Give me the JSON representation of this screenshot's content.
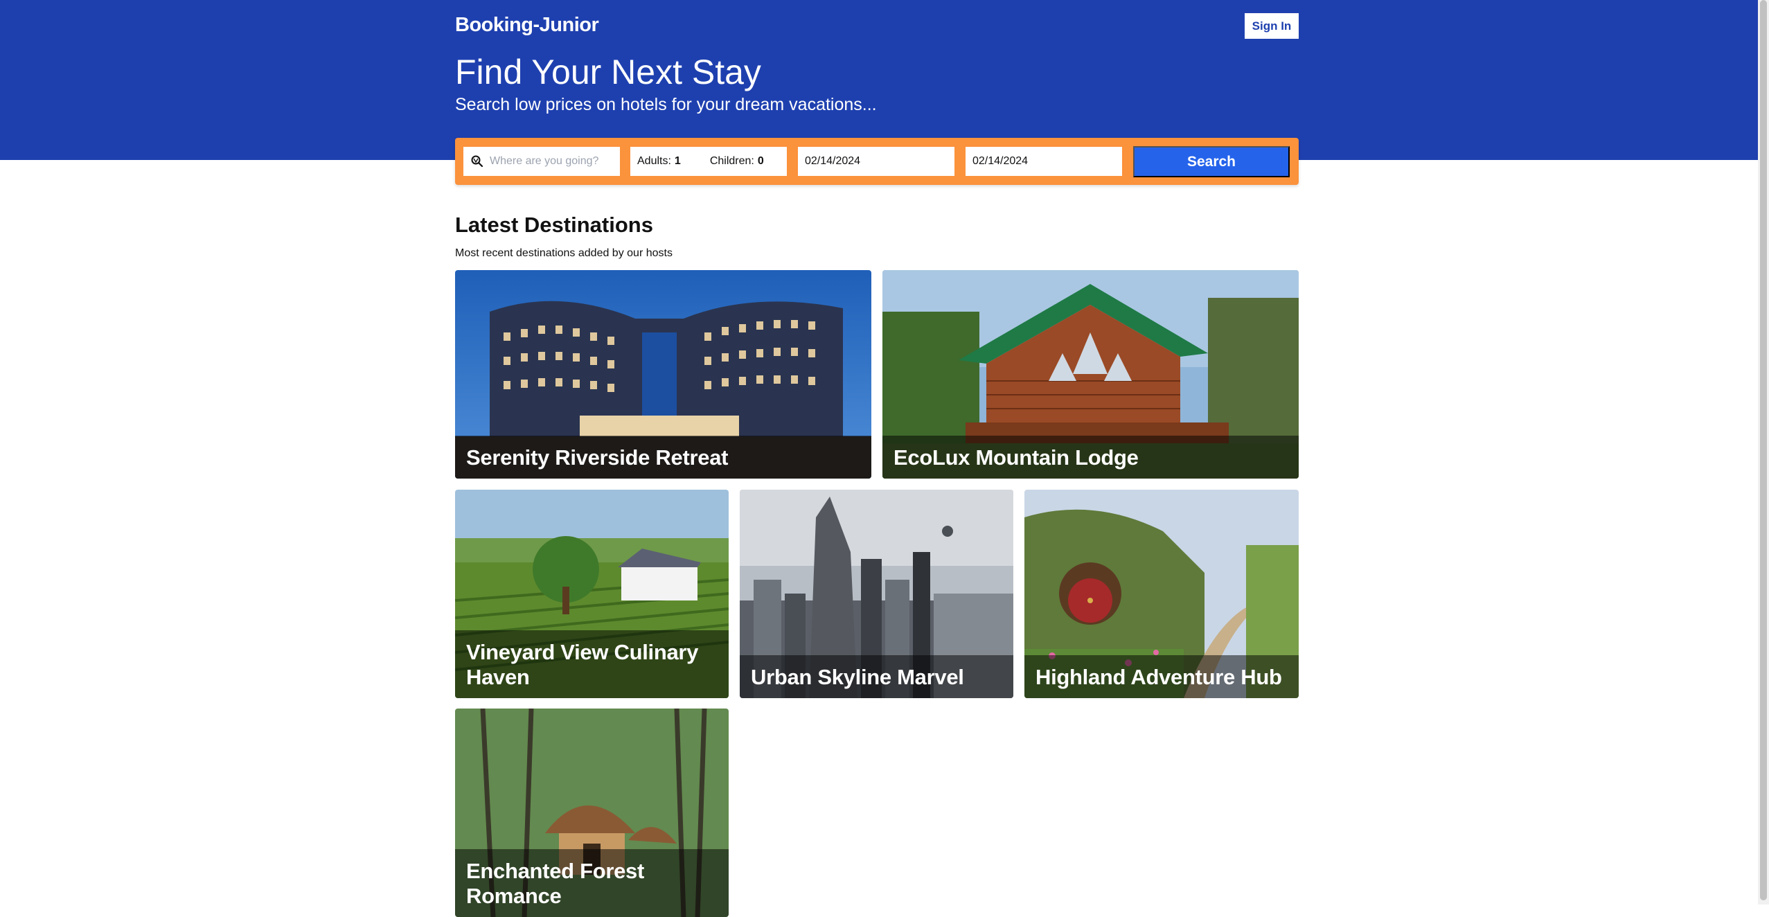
{
  "header": {
    "brand": "Booking-Junior",
    "sign_in_label": "Sign In",
    "hero_title": "Find Your Next Stay",
    "hero_subtitle": "Search low prices on hotels for your dream vacations..."
  },
  "search": {
    "destination_placeholder": "Where are you going?",
    "adults_label": "Adults:",
    "adults_value": "1",
    "children_label": "Children:",
    "children_value": "0",
    "check_in": "02/14/2024",
    "check_out": "02/14/2024",
    "button_label": "Search"
  },
  "section": {
    "title": "Latest Destinations",
    "subtitle": "Most recent destinations added by our hosts"
  },
  "destinations": [
    {
      "name": "Serenity Riverside Retreat"
    },
    {
      "name": "EcoLux Mountain Lodge"
    },
    {
      "name": "Vineyard View Culinary Haven"
    },
    {
      "name": "Urban Skyline Marvel"
    },
    {
      "name": "Highland Adventure Hub"
    },
    {
      "name": "Enchanted Forest Romance"
    }
  ],
  "colors": {
    "hero_bg": "#1e40af",
    "search_bar_bg": "#fb923c",
    "search_button_bg": "#2563eb"
  }
}
